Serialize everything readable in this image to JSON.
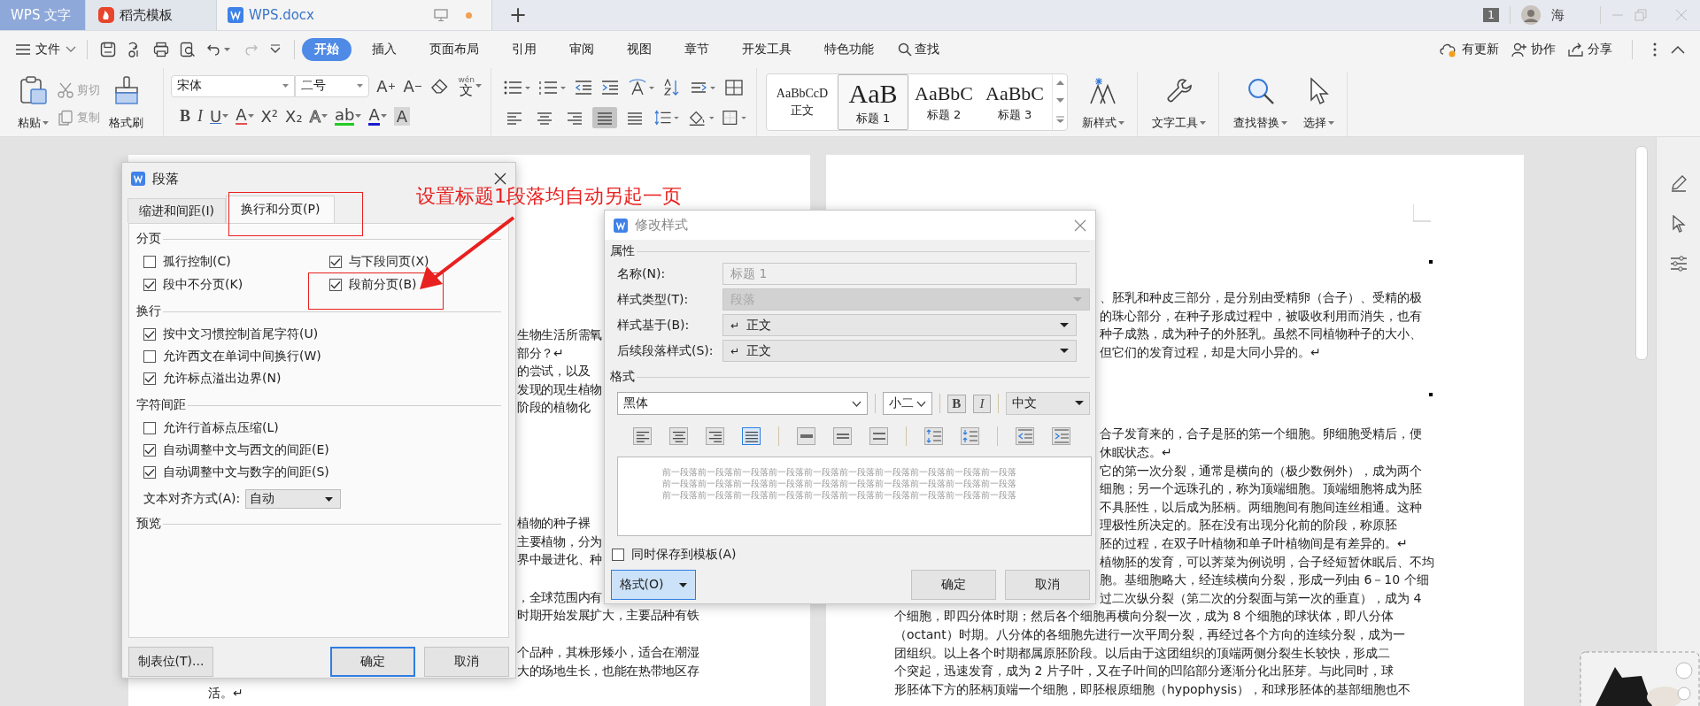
{
  "title_bar": {
    "tabs": [
      {
        "label": "WPS 文字",
        "kind": "home",
        "selected": false
      },
      {
        "label": "稻壳模板",
        "kind": "docer",
        "selected": false
      },
      {
        "label": "WPS.docx",
        "kind": "document",
        "selected": true
      }
    ],
    "new_tab": "+",
    "badge": "1",
    "user": "海"
  },
  "menu_bar": {
    "file": "文件",
    "tabs": [
      {
        "label": "开始",
        "selected": true
      },
      {
        "label": "插入",
        "selected": false
      },
      {
        "label": "页面布局",
        "selected": false
      },
      {
        "label": "引用",
        "selected": false
      },
      {
        "label": "审阅",
        "selected": false
      },
      {
        "label": "视图",
        "selected": false
      },
      {
        "label": "章节",
        "selected": false
      },
      {
        "label": "开发工具",
        "selected": false
      },
      {
        "label": "特色功能",
        "selected": false
      }
    ],
    "search": "查找",
    "actions": [
      "有更新",
      "协作",
      "分享"
    ]
  },
  "ribbon": {
    "paste": "粘贴",
    "clipboard": [
      {
        "label": "剪切",
        "disabled": true
      },
      {
        "label": "复制",
        "disabled": true
      }
    ],
    "format_painter": "格式刷",
    "font": "宋体",
    "size": "二号",
    "font_tools": [
      {
        "kind": "grow",
        "label": "A"
      },
      {
        "kind": "shrink",
        "label": "A"
      }
    ],
    "phonetic": {
      "label": "文",
      "ruby": "wén"
    },
    "font_buttons": [
      {
        "kind": "bold",
        "label": "B",
        "dropdown": false
      },
      {
        "kind": "italic",
        "label": "I",
        "dropdown": false
      },
      {
        "kind": "underline",
        "label": "U",
        "dropdown": true
      },
      {
        "kind": "strike",
        "label": "A",
        "dropdown": true
      },
      {
        "kind": "plain",
        "label": "X²",
        "dropdown": false
      },
      {
        "kind": "plain",
        "label": "X₂",
        "dropdown": false
      },
      {
        "kind": "outline",
        "label": "A",
        "dropdown": true
      },
      {
        "kind": "highlight",
        "label": "ab",
        "dropdown": true
      },
      {
        "kind": "color",
        "label": "A",
        "dropdown": true
      },
      {
        "kind": "shade",
        "label": "A",
        "dropdown": false
      }
    ],
    "alignment": [
      {
        "selected": false
      },
      {
        "selected": false
      },
      {
        "selected": false
      },
      {
        "selected": true
      },
      {
        "selected": false
      }
    ],
    "styles": [
      {
        "preview": "AaBbCcD",
        "label": "正文",
        "selected": false
      },
      {
        "preview": "AaB",
        "label": "标题 1",
        "selected": true
      },
      {
        "preview": "AaBbC",
        "label": "标题 2",
        "selected": false
      },
      {
        "preview": "AaBbC",
        "label": "标题 3",
        "selected": false
      }
    ],
    "commands": [
      "新样式",
      "文字工具",
      "查找替换",
      "选择"
    ]
  },
  "document": {
    "left_page": [
      [
        {
          "text": "生物生活所需氧",
          "behind_dialog": true
        },
        {
          "text": "部分？↵",
          "behind_dialog": true
        },
        {
          "text": "的尝试，以及",
          "behind_dialog": true
        },
        {
          "text": "发现的现生植物",
          "behind_dialog": true
        },
        {
          "text": "阶段的植物化",
          "behind_dialog": true
        }
      ],
      [
        {
          "text": "植物的种子裸",
          "behind_dialog": true
        },
        {
          "text": "主要植物，分为",
          "behind_dialog": true
        },
        {
          "text": "界中最进化、种",
          "behind_dialog": true
        }
      ],
      [
        {
          "text": "，全球范围内有",
          "behind_dialog": true
        },
        {
          "text": "时期开始发展扩大，主要品种有铁",
          "behind_dialog": true
        }
      ],
      [
        {
          "text": "个品种，其株形矮小，适合在潮湿",
          "behind_dialog": true
        },
        {
          "text": "大的场地生长，也能在热带地区存",
          "behind_dialog": true
        },
        {
          "text": "活。↵",
          "behind_dialog": false
        }
      ]
    ],
    "right_page": [
      [
        {
          "text": "、胚乳和种皮三部分，是分别由受精卵（合子）、受精的极",
          "behind_dialog": true
        },
        {
          "text": "的珠心部分，在种子形成过程中，被吸收利用而消失，也有",
          "behind_dialog": true
        },
        {
          "text": "种子成熟，成为种子的外胚乳。虽然不同植物种子的大小、",
          "behind_dialog": true
        },
        {
          "text": "但它们的发育过程，却是大同小异的。↵",
          "behind_dialog": true
        }
      ],
      [
        {
          "text": "合子发育来的，合子是胚的第一个细胞。卵细胞受精后，便",
          "behind_dialog": true
        },
        {
          "text": "休眠状态。↵",
          "behind_dialog": true
        },
        {
          "text": "它的第一次分裂，通常是横向的（极少数例外），成为两个",
          "behind_dialog": true
        },
        {
          "text": "细胞；另一个远珠孔的，称为顶端细胞。顶端细胞将成为胚",
          "behind_dialog": true
        },
        {
          "text": "不具胚性，以后成为胚柄。两细胞间有胞间连丝相通。这种",
          "behind_dialog": true
        },
        {
          "text": "理极性所决定的。胚在没有出现分化前的阶段，称原胚",
          "behind_dialog": true
        },
        {
          "text": "胚的过程，在双子叶植物和单子叶植物间是有差异的。↵",
          "behind_dialog": true
        },
        {
          "text": "植物胚的发育，可以荠菜为例说明，合子经短暂休眠后、不均",
          "behind_dialog": true
        },
        {
          "text": "胞。基细胞略大，经连续横向分裂，形成一列由 6－10 个细",
          "behind_dialog": true
        },
        {
          "text": "过二次纵分裂（第二次的分裂面与第一次的垂直），成为 4",
          "behind_dialog": true
        },
        {
          "text": "个细胞，即四分体时期；然后各个细胞再横向分裂一次，成为 8 个细胞的球状体，即八分体",
          "behind_dialog": false
        },
        {
          "text": "（octant）时期。八分体的各细胞先进行一次平周分裂，再经过各个方向的连续分裂，成为一",
          "behind_dialog": false
        },
        {
          "text": "团组织。以上各个时期都属原胚阶段。以后由于这团组织的顶端两侧分裂生长较快，形成二",
          "behind_dialog": false
        },
        {
          "text": "个突起，迅速发育，成为 2 片子叶，又在子叶间的凹陷部分逐渐分化出胚芽。与此同时，球",
          "behind_dialog": false
        },
        {
          "text": "形胚体下方的胚柄顶端一个细胞，即胚根原细胞（hypophysis），和球形胚体的基部细胞也不",
          "behind_dialog": false
        }
      ]
    ]
  },
  "paragraph_dialog": {
    "title": "段落",
    "tabs": [
      {
        "label": "缩进和间距(I)",
        "selected": false
      },
      {
        "label": "换行和分页(P)",
        "selected": true
      }
    ],
    "sections": [
      {
        "title": "分页",
        "kind": "grid",
        "options": [
          {
            "label": "孤行控制(C)",
            "checked": false
          },
          {
            "label": "与下段同页(X)",
            "checked": true
          },
          {
            "label": "段中不分页(K)",
            "checked": true
          },
          {
            "label": "段前分页(B)",
            "checked": true
          }
        ]
      },
      {
        "title": "换行",
        "kind": "list",
        "options": [
          {
            "label": "按中文习惯控制首尾字符(U)",
            "checked": true
          },
          {
            "label": "允许西文在单词中间换行(W)",
            "checked": false
          },
          {
            "label": "允许标点溢出边界(N)",
            "checked": true
          }
        ]
      },
      {
        "title": "字符间距",
        "kind": "list",
        "options": [
          {
            "label": "允许行首标点压缩(L)",
            "checked": false
          },
          {
            "label": "自动调整中文与西文的间距(E)",
            "checked": true
          },
          {
            "label": "自动调整中文与数字的间距(S)",
            "checked": true
          }
        ],
        "align_label": "文本对齐方式(A):",
        "align_value": "自动"
      },
      {
        "title": "预览",
        "kind": "preview"
      }
    ],
    "buttons": [
      {
        "label": "制表位(T)...",
        "default": false
      },
      {
        "label": "确定",
        "default": true
      },
      {
        "label": "取消",
        "default": false
      }
    ]
  },
  "style_dialog": {
    "title": "修改样式",
    "properties_title": "属性",
    "fields": [
      {
        "label": "名称(N):",
        "value": "标题 1",
        "kind": "text",
        "disabled": true
      },
      {
        "label": "样式类型(T):",
        "value": "段落",
        "kind": "select",
        "disabled": true
      },
      {
        "label": "样式基于(B):",
        "symbol": "↵",
        "value": "正文",
        "kind": "select",
        "disabled": false
      },
      {
        "label": "后续段落样式(S):",
        "symbol": "↵",
        "value": "正文",
        "kind": "select",
        "disabled": false
      }
    ],
    "format_title": "格式",
    "font": "黑体",
    "size": "小二",
    "bold": "B",
    "italic": "I",
    "script": "中文",
    "align_buttons": [
      {
        "selected": false
      },
      {
        "selected": false
      },
      {
        "selected": false
      },
      {
        "selected": true
      },
      {
        "selected": false
      },
      {
        "selected": false
      },
      {
        "selected": false
      },
      {
        "selected": false
      },
      {
        "selected": false
      },
      {
        "selected": false
      },
      {
        "selected": false
      }
    ],
    "preview_lines": [
      "前一段落前一段落前一段落前一段落前一段落前一段落前一段落前一段落前一段落前一段落",
      "前一段落前一段落前一段落前一段落前一段落前一段落前一段落前一段落前一段落前一段落",
      "前一段落前一段落前一段落前一段落前一段落前一段落前一段落前一段落前一段落前一段落"
    ],
    "save_template": {
      "label": "同时保存到模板(A)",
      "checked": false
    },
    "format_button": "格式(O)",
    "buttons": [
      "确定",
      "取消"
    ]
  },
  "annotation": {
    "text": "设置标题1段落均自动另起一页"
  }
}
